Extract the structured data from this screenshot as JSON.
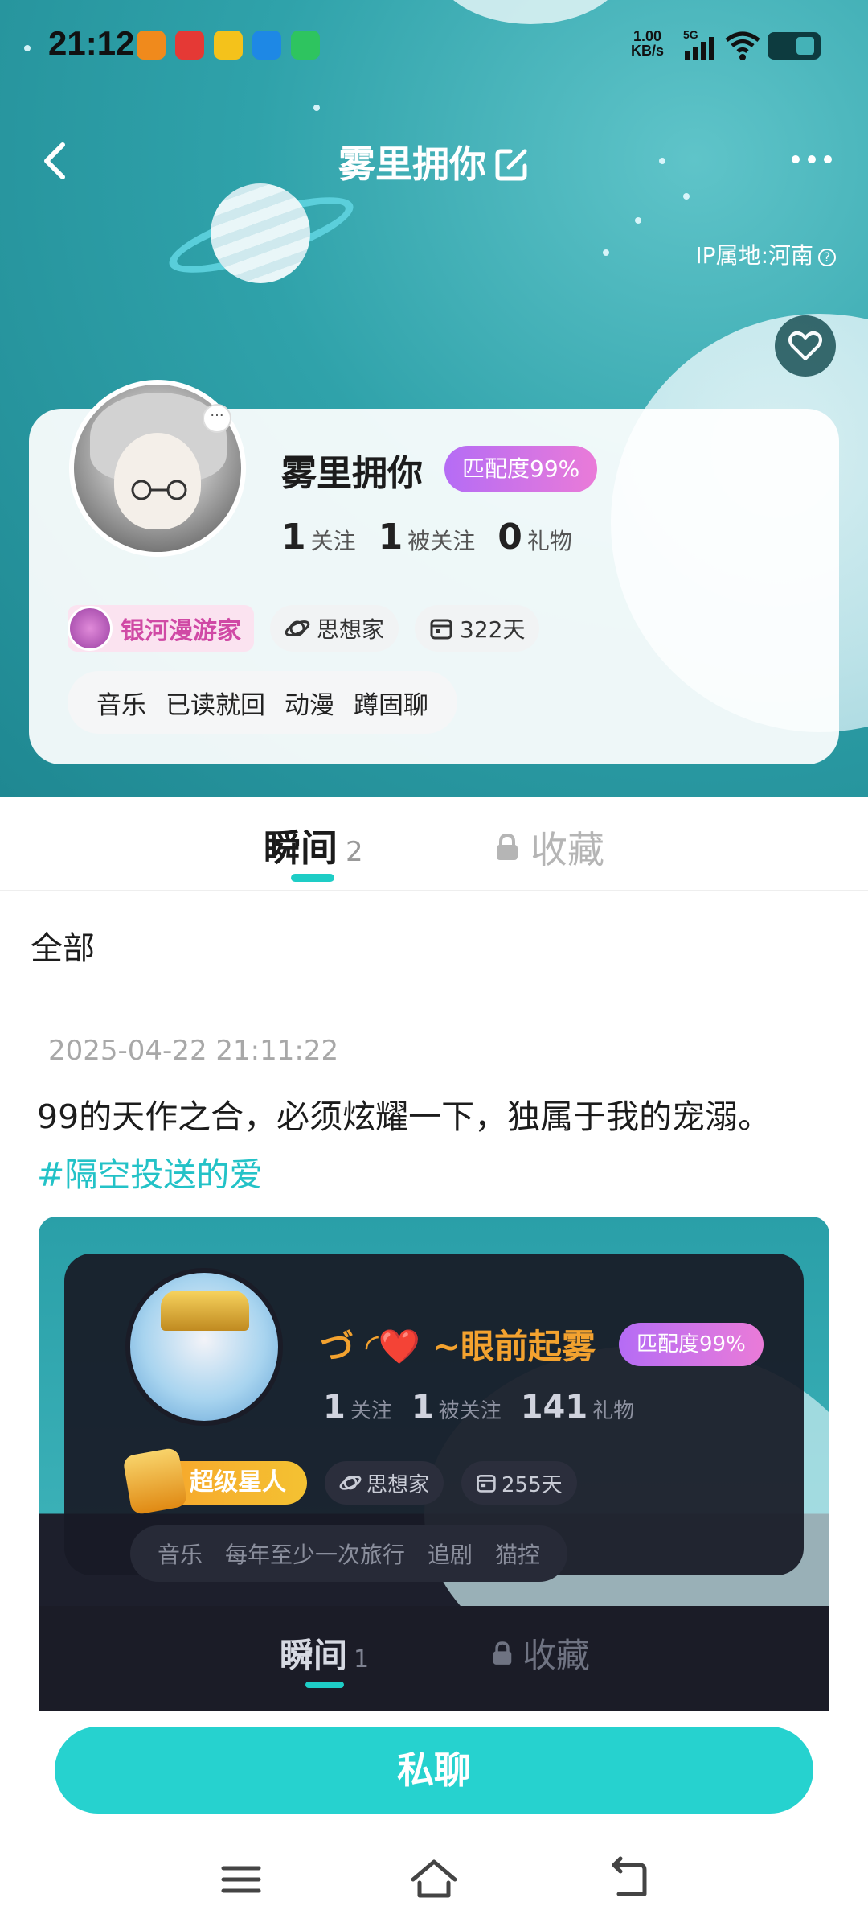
{
  "status_bar": {
    "time": "21:12",
    "net_speed_value": "1.00",
    "net_speed_unit": "KB/s",
    "signal_label": "5G",
    "app_icons": [
      "video-app-icon",
      "red-video-app-icon",
      "game-app-icon",
      "blue-app-icon",
      "wechat-icon"
    ]
  },
  "nav": {
    "title": "雾里拥你",
    "ip_location": "IP属地:河南"
  },
  "profile": {
    "name": "雾里拥你",
    "match": "匹配度99%",
    "stats": [
      {
        "num": "1",
        "label": "关注"
      },
      {
        "num": "1",
        "label": "被关注"
      },
      {
        "num": "0",
        "label": "礼物"
      }
    ],
    "level": "银河漫游家",
    "persona": "思想家",
    "days": "322天",
    "interests": [
      "音乐",
      "已读就回",
      "动漫",
      "蹲固聊"
    ]
  },
  "tabs": {
    "moment_label": "瞬间",
    "moment_count": "2",
    "favorites_label": "收藏"
  },
  "filter": {
    "all_label": "全部"
  },
  "post": {
    "timestamp": "2025-04-22 21:11:22",
    "text": "99的天作之合，必须炫耀一下，独属于我的宠溺。",
    "hashtag": "#隔空投送的爱",
    "image": {
      "name": "づ ◜❤️ ~眼前起雾",
      "match": "匹配度99%",
      "stats": [
        {
          "num": "1",
          "label": "关注"
        },
        {
          "num": "1",
          "label": "被关注"
        },
        {
          "num": "141",
          "label": "礼物"
        }
      ],
      "level": "超级星人",
      "persona": "思想家",
      "days": "255天",
      "interests": [
        "音乐",
        "每年至少一次旅行",
        "追剧",
        "猫控"
      ],
      "moment_label": "瞬间",
      "moment_count": "1",
      "favorites_label": "收藏"
    }
  },
  "bottom": {
    "chat_button": "私聊"
  },
  "colors": {
    "accent": "#26d2cf",
    "hero_bg": "#2fa2aa",
    "match_badge_start": "#b56cf5",
    "match_badge_end": "#ea7bd8",
    "hashtag": "#23c2c7"
  }
}
